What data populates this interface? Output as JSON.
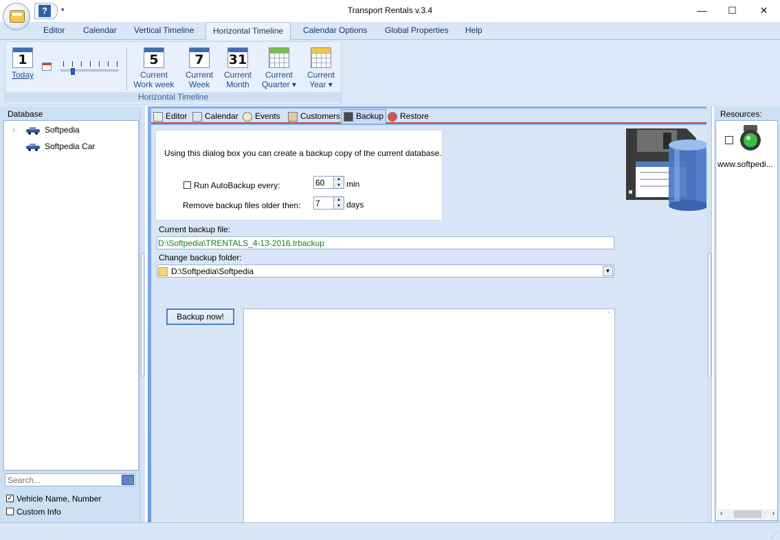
{
  "window": {
    "title": "Transport Rentals v.3.4",
    "minimize": "—",
    "maximize": "☐",
    "close": "✕",
    "quick_access_help": "?",
    "quick_access_dropdown": "▾"
  },
  "menu": {
    "tabs": [
      "Editor",
      "Calendar",
      "Vertical Timeline",
      "Horizontal Timeline",
      "Calendar Options",
      "Global Properties",
      "Help"
    ],
    "active": "Horizontal Timeline"
  },
  "ribbon": {
    "group_label": "Horizontal Timeline",
    "today": {
      "num": "1",
      "label": "Today"
    },
    "buttons": [
      {
        "num": "5",
        "line1": "Current",
        "line2": "Work week"
      },
      {
        "num": "7",
        "line1": "Current",
        "line2": "Week"
      },
      {
        "num": "31",
        "line1": "Current",
        "line2": "Month"
      },
      {
        "line1": "Current",
        "line2": "Quarter ▾"
      },
      {
        "line1": "Current",
        "line2": "Year ▾"
      }
    ]
  },
  "left_panel": {
    "title": "Database",
    "tree": [
      "Softpedia",
      "Softpedia Car"
    ],
    "search_placeholder": "Search...",
    "checkbox1": {
      "label": "Vehicle Name, Number",
      "checked": true
    },
    "checkbox2": {
      "label": "Custom Info",
      "checked": false
    }
  },
  "subtabs": [
    "Editor",
    "Calendar",
    "Events",
    "Customers",
    "Backup",
    "Restore"
  ],
  "backup": {
    "intro": "Using this dialog box you can create a backup copy of the current database.",
    "autobackup_label": "Run AutoBackup every:",
    "autobackup_value": "60",
    "autobackup_unit": "min",
    "remove_label": "Remove backup files older then:",
    "remove_value": "7",
    "remove_unit": "days",
    "current_file_label": "Current backup file:",
    "current_file_value": "D:\\Softpedia\\TRENTALS_4-13-2016.trbackup",
    "change_folder_label": "Change backup folder:",
    "folder_value": "D:\\Softpedia\\Softpedia",
    "backup_now": "Backup now!"
  },
  "right_panel": {
    "title": "Resources:",
    "resource_label": "www.softpedi..."
  },
  "colors": {
    "accent": "#3f6cb4",
    "tab_underline": "#c0464a",
    "path_text": "#1a7a1a"
  }
}
